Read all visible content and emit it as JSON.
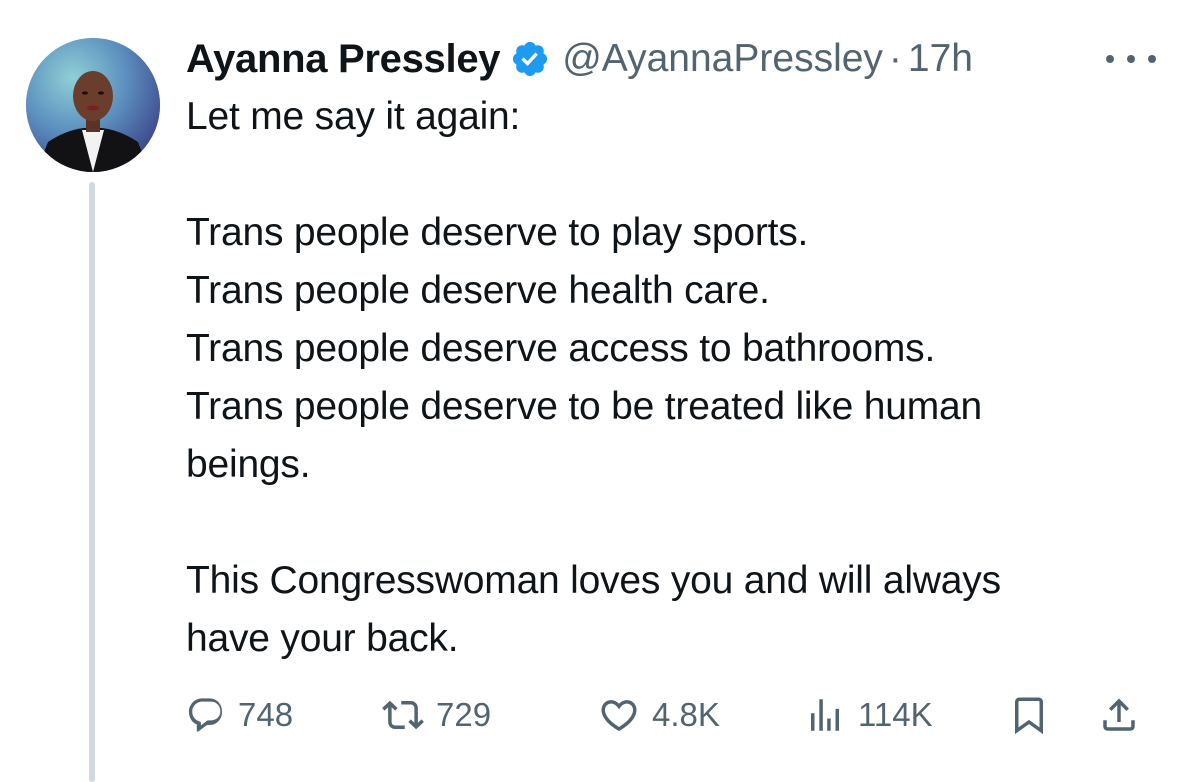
{
  "tweet": {
    "display_name": "Ayanna Pressley",
    "handle": "@AyannaPressley",
    "separator": "·",
    "time": "17h",
    "lines": [
      "Let me say it again:",
      "",
      "Trans people deserve to play sports.",
      "Trans people deserve health care.",
      "Trans people deserve access to bathrooms.",
      "Trans people deserve to be treated like human",
      "beings.",
      "",
      "This Congresswoman loves you and will always",
      "have your back."
    ]
  },
  "actions": {
    "replies": "748",
    "reposts": "729",
    "likes": "4.8K",
    "views": "114K"
  },
  "colors": {
    "text": "#0f1419",
    "secondary": "#536471",
    "verified": "#1d9bf0",
    "thread_line": "#cfd9de"
  }
}
